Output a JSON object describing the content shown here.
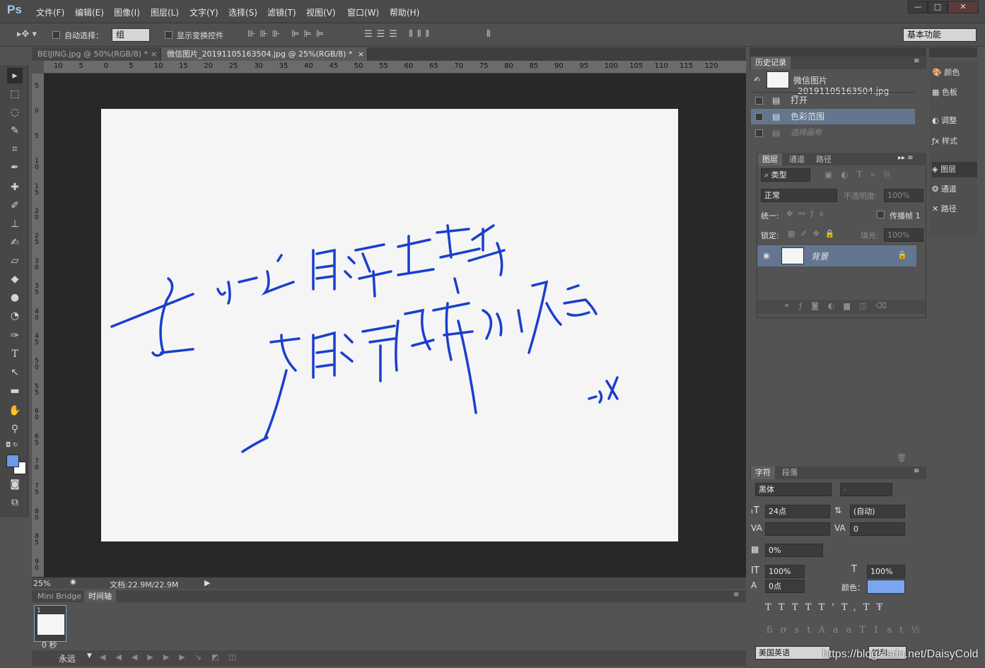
{
  "app": {
    "logo": "Ps"
  },
  "menus": [
    "文件(F)",
    "编辑(E)",
    "图像(I)",
    "图层(L)",
    "文字(Y)",
    "选择(S)",
    "滤镜(T)",
    "视图(V)",
    "窗口(W)",
    "帮助(H)"
  ],
  "options": {
    "auto_select_label": "自动选择：",
    "auto_select_value": "组",
    "show_transform_label": "显示变换控件",
    "workspace": "基本功能"
  },
  "tabs": [
    {
      "label": "BEIJING.jpg @ 50%(RGB/8) *"
    },
    {
      "label": "微信图片_20191105163504.jpg @ 25%(RGB/8) *"
    }
  ],
  "ruler_h": [
    "10",
    "5",
    "0",
    "5",
    "10",
    "15",
    "20",
    "25",
    "30",
    "35",
    "40",
    "45",
    "50",
    "55",
    "60",
    "65",
    "70",
    "75",
    "80",
    "85",
    "90",
    "95",
    "100",
    "105",
    "110",
    "115",
    "120"
  ],
  "ruler_v": [
    "5",
    "0",
    "5",
    "1 0",
    "1 5",
    "2 0",
    "2 5",
    "3 0",
    "3 5",
    "4 0",
    "4 5",
    "5 0",
    "5 5",
    "6 0",
    "6 5",
    "7 0",
    "7 5",
    "8 0",
    "8 5",
    "9 0"
  ],
  "status": {
    "zoom": "25%",
    "doc": "文档:22.9M/22.9M"
  },
  "bottom": {
    "tab_bridge": "Mini Bridge",
    "tab_timeline": "时间轴",
    "frame_num": "1",
    "frame_time": "0 秒",
    "loop": "永远"
  },
  "history": {
    "title": "历史记录",
    "snapshot": "微信图片_20191105163504.jpg",
    "items": [
      "打开",
      "色彩范围",
      "选择画布"
    ]
  },
  "layers": {
    "tabs": [
      "图层",
      "通道",
      "路径"
    ],
    "kind": "类型",
    "blend": "正常",
    "opacity_label": "不透明度:",
    "opacity": "100%",
    "unify_label": "统一:",
    "propagate_label": "传播帧 1",
    "lock_label": "锁定:",
    "fill_label": "填充:",
    "fill": "100%",
    "layer_name": "背景"
  },
  "side_icons": [
    "颜色",
    "色板",
    "调整",
    "样式",
    "图层",
    "通道",
    "路径"
  ],
  "character": {
    "tabs": [
      "字符",
      "段落"
    ],
    "font": "黑体",
    "style": "-",
    "size": "24点",
    "leading": "(自动)",
    "tracking": "0",
    "scale_pct": "0%",
    "vscale": "100%",
    "hscale": "100%",
    "baseline": "0点",
    "color_label": "颜色：",
    "color": "#7aa6f0",
    "language": "美国英语",
    "aa": "锐利"
  },
  "watermark": "https://blog.csdn.net/DaisyCold"
}
